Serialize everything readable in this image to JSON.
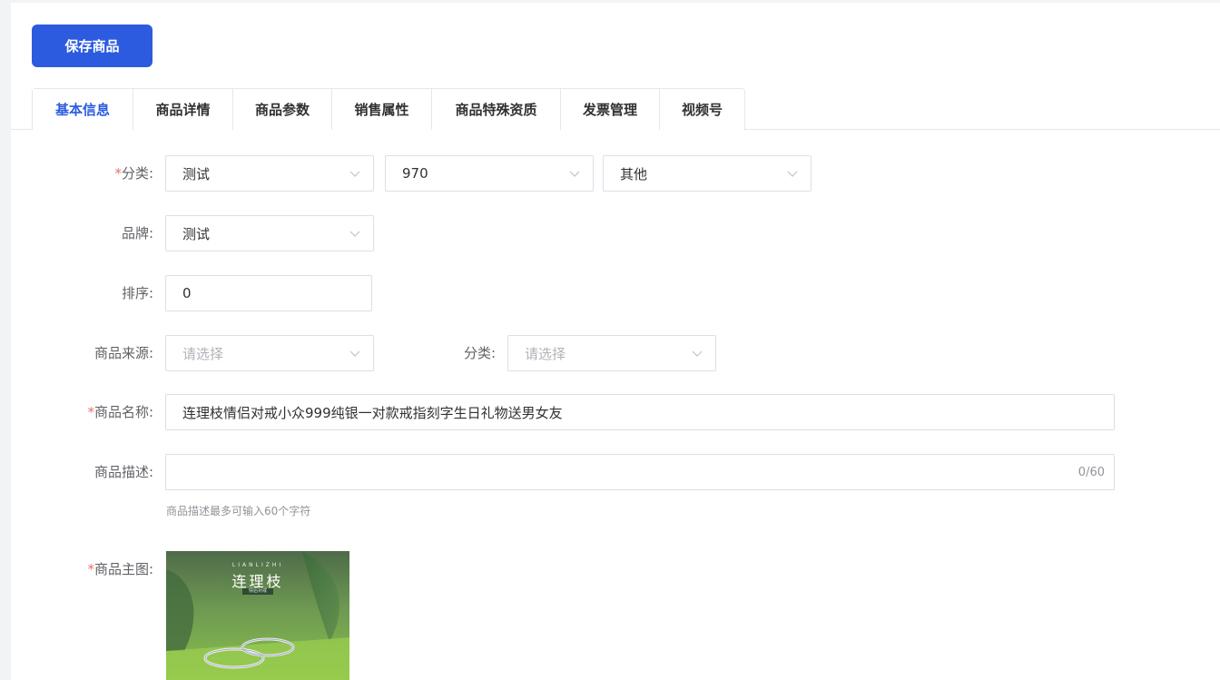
{
  "toolbar": {
    "save_label": "保存商品"
  },
  "tabs": [
    {
      "label": "基本信息",
      "active": true
    },
    {
      "label": "商品详情",
      "active": false
    },
    {
      "label": "商品参数",
      "active": false
    },
    {
      "label": "销售属性",
      "active": false
    },
    {
      "label": "商品特殊资质",
      "active": false
    },
    {
      "label": "发票管理",
      "active": false
    },
    {
      "label": "视频号",
      "active": false
    }
  ],
  "form": {
    "category": {
      "required_mark": "*",
      "label": "分类:",
      "level1": "测试",
      "level2": "970",
      "level3": "其他"
    },
    "brand": {
      "label": "品牌:",
      "value": "测试"
    },
    "sort": {
      "label": "排序:",
      "value": "0"
    },
    "source": {
      "label": "商品来源:",
      "placeholder": "请选择"
    },
    "source_category": {
      "label": "分类:",
      "placeholder": "请选择"
    },
    "name": {
      "required_mark": "*",
      "label": "商品名称:",
      "value": "连理枝情侣对戒小众999纯银一对款戒指刻字生日礼物送男女友"
    },
    "description": {
      "label": "商品描述:",
      "value": "",
      "counter": "0/60",
      "hint": "商品描述最多可输入60个字符"
    },
    "main_image": {
      "required_mark": "*",
      "label": "商品主图:",
      "brand_en": "LIANLIZHI",
      "brand_cn": "连理枝",
      "brand_tag": "情侣对戒"
    }
  },
  "colors": {
    "primary": "#2c5be0",
    "required": "#f56c6c",
    "border": "#dcdfe6"
  }
}
